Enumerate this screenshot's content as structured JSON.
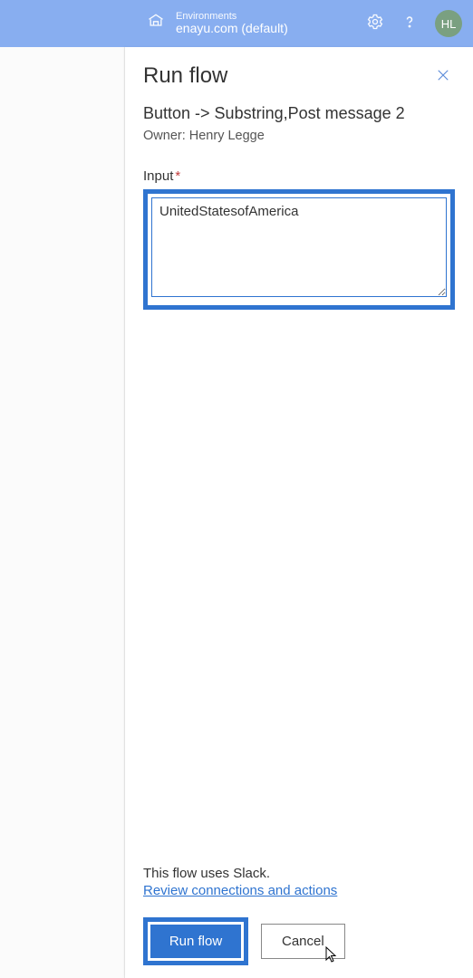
{
  "topbar": {
    "env_label": "Environments",
    "env_name": "enayu.com (default)",
    "avatar_initials": "HL"
  },
  "panel": {
    "title": "Run flow",
    "flow_name": "Button -> Substring,Post message 2",
    "owner_label": "Owner: Henry Legge",
    "input_label": "Input",
    "input_value": "UnitedStatesofAmerica"
  },
  "footer": {
    "uses_text": "This flow uses Slack.",
    "review_link": "Review connections and actions",
    "run_label": "Run flow",
    "cancel_label": "Cancel"
  }
}
